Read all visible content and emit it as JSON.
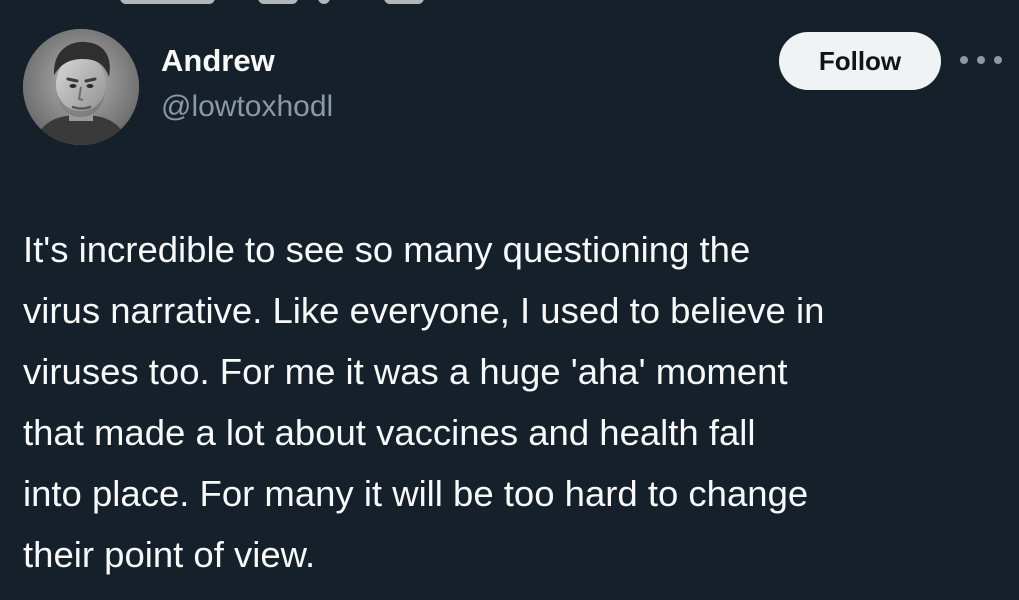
{
  "tweet": {
    "author": {
      "display_name": "Andrew",
      "handle": "@lowtoxhodl",
      "avatar_icon": "profile-photo"
    },
    "follow_label": "Follow",
    "more_icon": "more-options-icon",
    "text_lines": [
      "It's incredible to see so many questioning the",
      "virus narrative. Like everyone, I used to believe in",
      "viruses too. For me it was a huge 'aha' moment",
      "that made a lot about vaccines and health fall",
      "into place. For many it will be too hard to change",
      "their point of view."
    ]
  },
  "colors": {
    "background": "#15202b",
    "text": "#f7f9f9",
    "secondary_text": "#8b98a5",
    "follow_button_bg": "#eff3f4",
    "follow_button_text": "#0f1419"
  }
}
